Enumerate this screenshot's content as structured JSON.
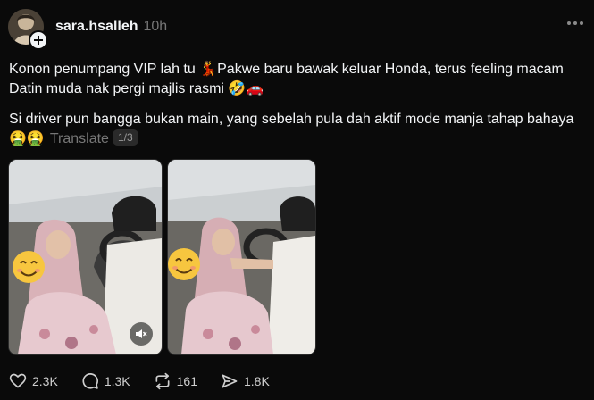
{
  "post": {
    "username": "sara.hsalleh",
    "time": "10h",
    "paragraph1": "Konon penumpang VIP lah tu 💃Pakwe baru bawak keluar Honda, terus feeling macam Datin muda nak pergi majlis rasmi 🤣🚗",
    "paragraph2": "Si driver pun bangga bukan main, yang sebelah pula dah aktif mode manja tahap bahaya 🤮🤮",
    "translate_label": "Translate",
    "page_indicator": "1/3"
  },
  "actions": {
    "likes": "2.3K",
    "comments": "1.3K",
    "reposts": "161",
    "shares": "1.8K"
  },
  "icons": {
    "follow": "plus-icon",
    "more": "more-dots-icon",
    "mute": "mute-icon",
    "like": "heart-icon",
    "comment": "comment-icon",
    "repost": "repost-icon",
    "share": "send-icon"
  },
  "colors": {
    "background": "#0a0a0a",
    "text": "#f3f5f7",
    "muted": "#777777"
  }
}
